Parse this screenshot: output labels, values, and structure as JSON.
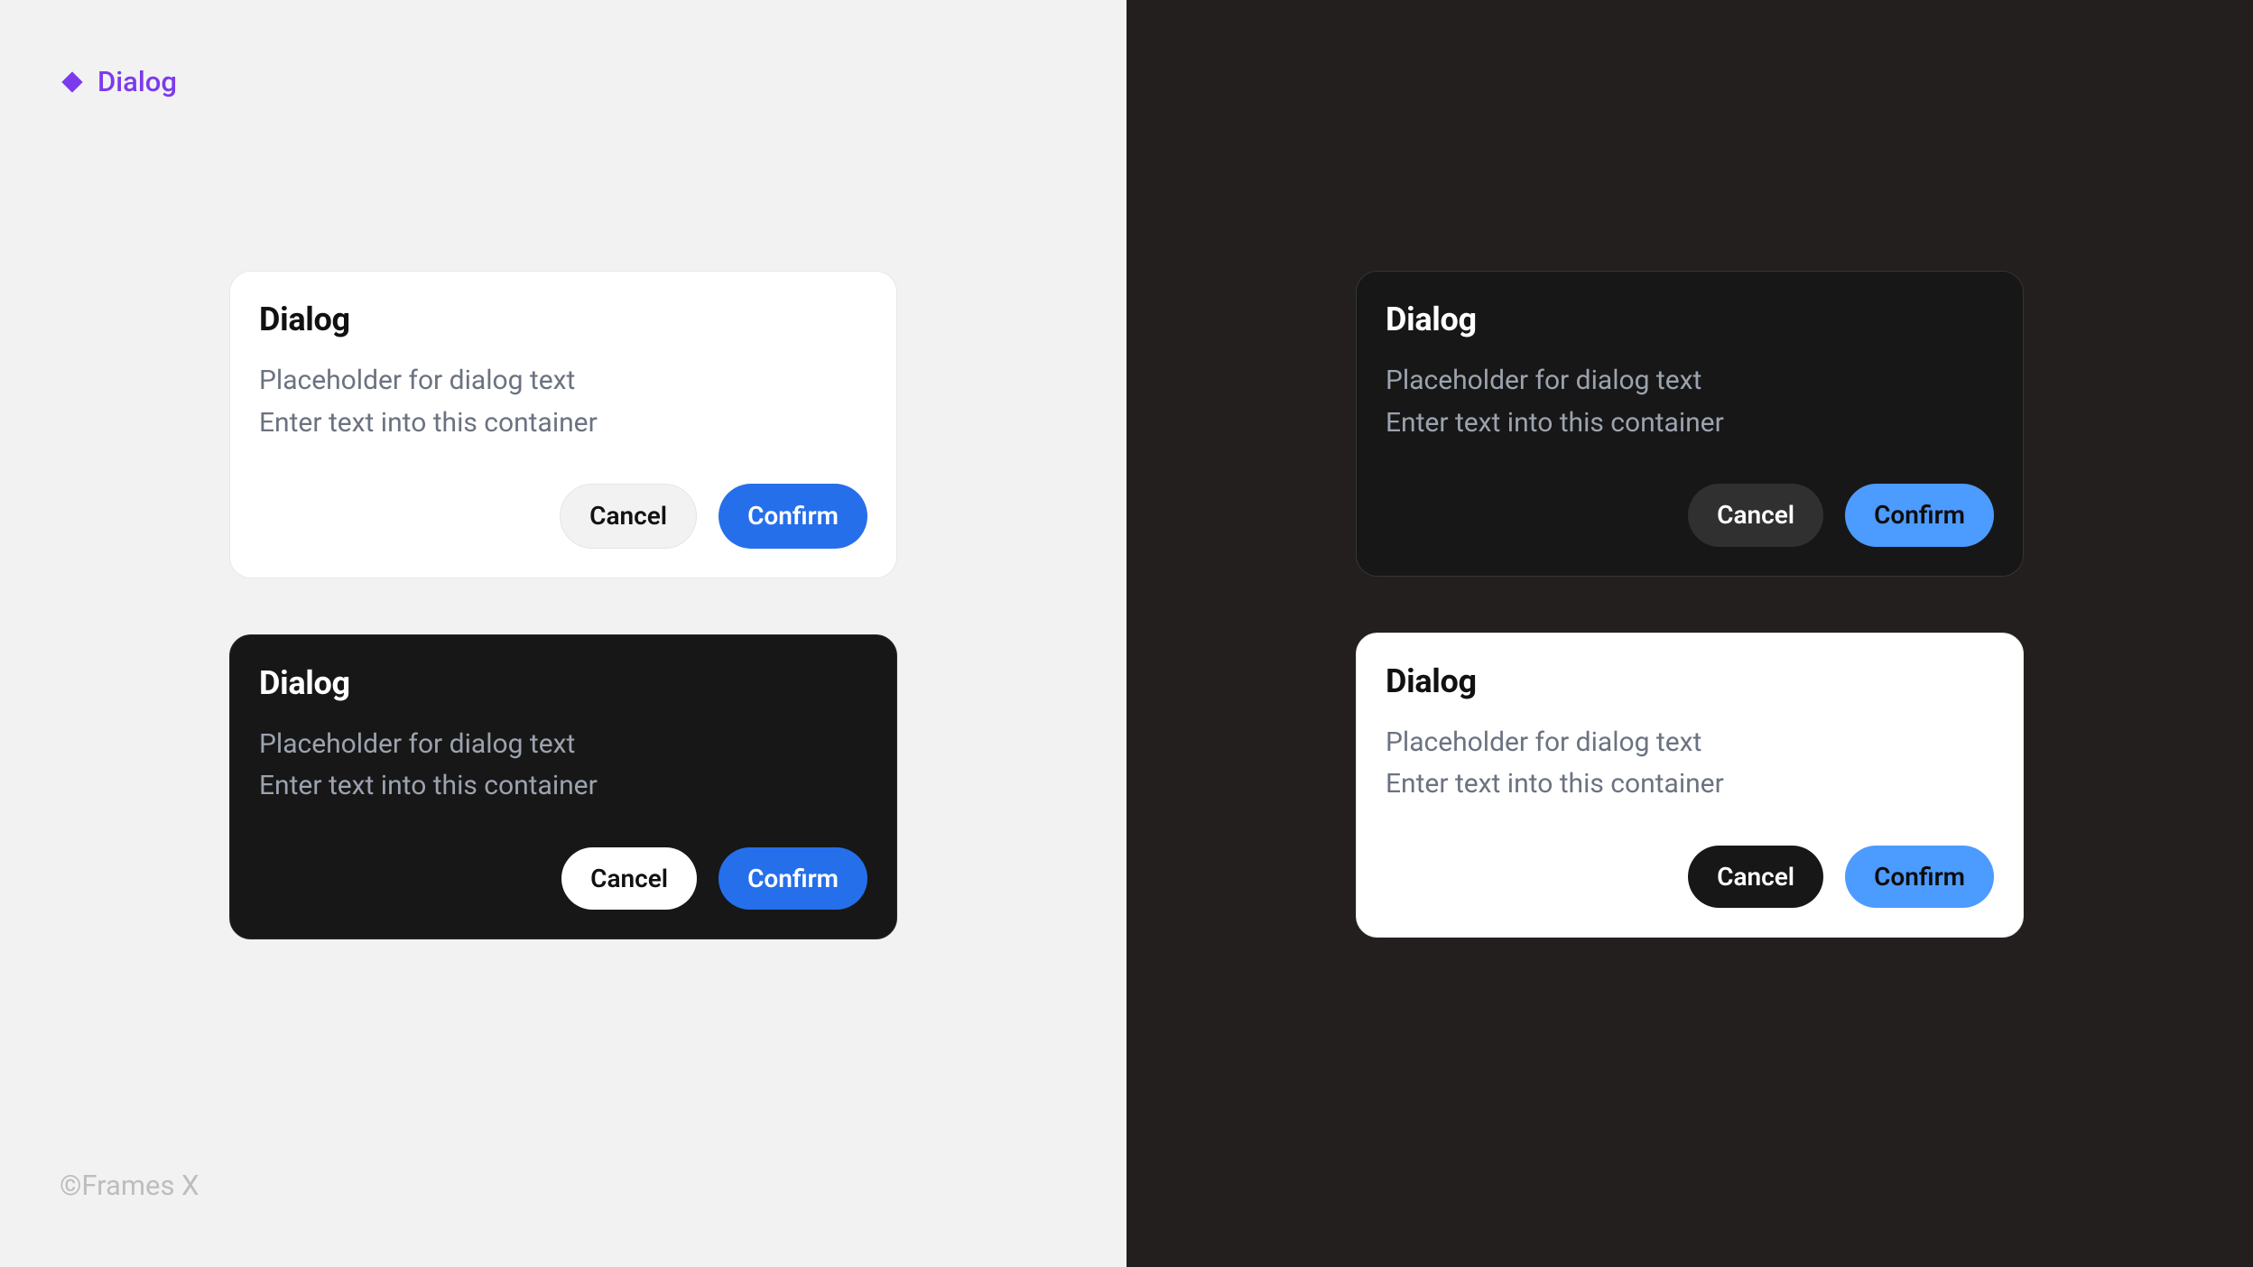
{
  "header": {
    "component_label": "Dialog"
  },
  "footer": {
    "credit": "©Frames X"
  },
  "dialogs": {
    "light_on_light": {
      "title": "Dialog",
      "body_line1": "Placeholder for dialog text",
      "body_line2": "Enter text into this container",
      "cancel": "Cancel",
      "confirm": "Confirm"
    },
    "dark_on_light": {
      "title": "Dialog",
      "body_line1": "Placeholder for dialog text",
      "body_line2": "Enter text into this container",
      "cancel": "Cancel",
      "confirm": "Confirm"
    },
    "dark_on_dark": {
      "title": "Dialog",
      "body_line1": "Placeholder for dialog text",
      "body_line2": "Enter text into this container",
      "cancel": "Cancel",
      "confirm": "Confirm"
    },
    "light_on_dark": {
      "title": "Dialog",
      "body_line1": "Placeholder for dialog text",
      "body_line2": "Enter text into this container",
      "cancel": "Cancel",
      "confirm": "Confirm"
    }
  }
}
